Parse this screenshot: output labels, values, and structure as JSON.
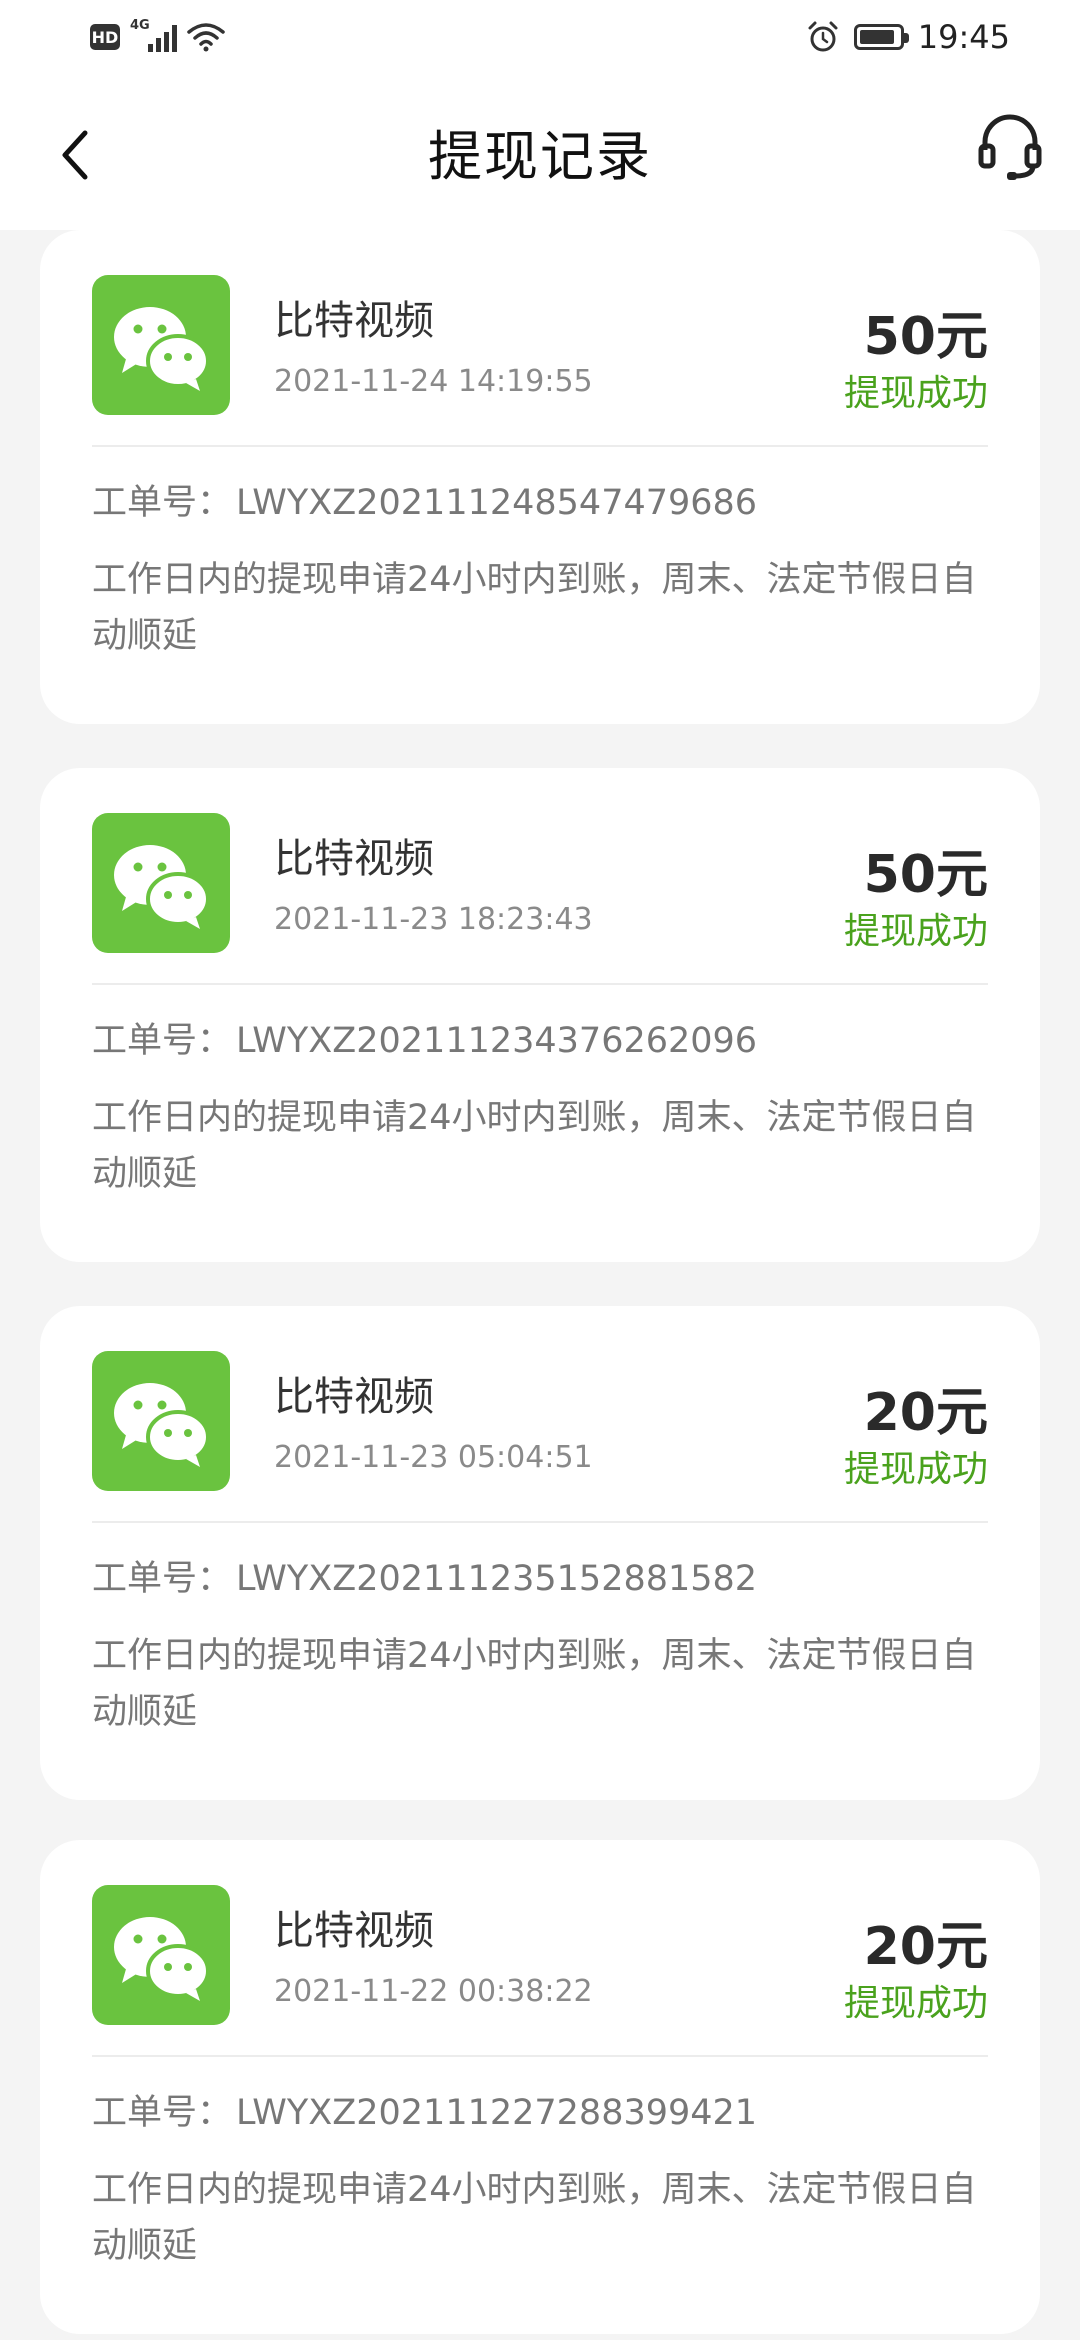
{
  "status_bar": {
    "hd": "HD",
    "network": "4G",
    "time": "19:45"
  },
  "nav": {
    "title": "提现记录",
    "back_icon": "chevron-left-icon",
    "service_icon": "headset-icon"
  },
  "colors": {
    "accent_green": "#4aa21d",
    "wechat_green": "#6ac33f"
  },
  "records": [
    {
      "app_name": "比特视频",
      "time": "2021-11-24 14:19:55",
      "amount": "50元",
      "status": "提现成功",
      "order_label": "工单号：",
      "order_no": "LWYXZ202111248547479686",
      "note": "工作日内的提现申请24小时内到账，周末、法定节假日自动顺延"
    },
    {
      "app_name": "比特视频",
      "time": "2021-11-23 18:23:43",
      "amount": "50元",
      "status": "提现成功",
      "order_label": "工单号：",
      "order_no": "LWYXZ202111234376262096",
      "note": "工作日内的提现申请24小时内到账，周末、法定节假日自动顺延"
    },
    {
      "app_name": "比特视频",
      "time": "2021-11-23 05:04:51",
      "amount": "20元",
      "status": "提现成功",
      "order_label": "工单号：",
      "order_no": "LWYXZ202111235152881582",
      "note": "工作日内的提现申请24小时内到账，周末、法定节假日自动顺延"
    },
    {
      "app_name": "比特视频",
      "time": "2021-11-22 00:38:22",
      "amount": "20元",
      "status": "提现成功",
      "order_label": "工单号：",
      "order_no": "LWYXZ202111227288399421",
      "note": "工作日内的提现申请24小时内到账，周末、法定节假日自动顺延"
    }
  ]
}
